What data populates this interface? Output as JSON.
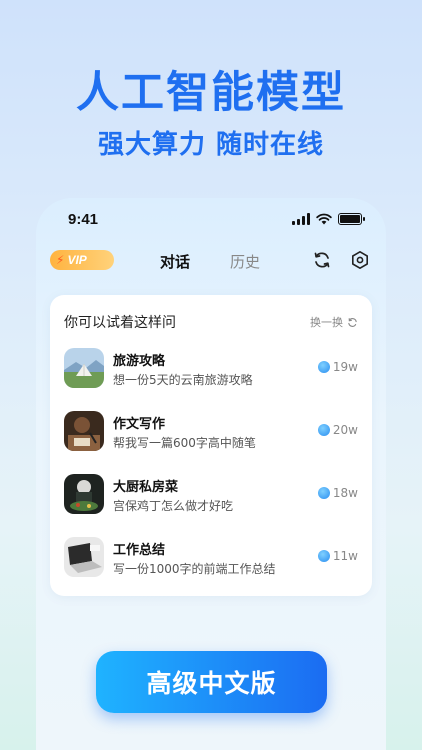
{
  "headline": "人工智能模型",
  "subline": "强大算力 随时在线",
  "status_bar": {
    "time": "9:41"
  },
  "header": {
    "vip_label": "VIP",
    "tabs": [
      "对话",
      "历史"
    ]
  },
  "card": {
    "title": "你可以试着这样问",
    "shuffle_label": "换一换",
    "items": [
      {
        "title": "旅游攻略",
        "desc": "想一份5天的云南旅游攻略",
        "count": "19w",
        "thumb": "tent-landscape"
      },
      {
        "title": "作文写作",
        "desc": "帮我写一篇600字高中随笔",
        "count": "20w",
        "thumb": "writing-desk"
      },
      {
        "title": "大厨私房菜",
        "desc": "宫保鸡丁怎么做才好吃",
        "count": "18w",
        "thumb": "chef-cooking"
      },
      {
        "title": "工作总结",
        "desc": "写一份1000字的前端工作总结",
        "count": "11w",
        "thumb": "laptop"
      }
    ]
  },
  "cta_label": "高级中文版",
  "colors": {
    "accent": "#1f6ff0",
    "cta_start": "#1fb3ff",
    "cta_end": "#1b6cf2",
    "vip": "#ffb340"
  }
}
